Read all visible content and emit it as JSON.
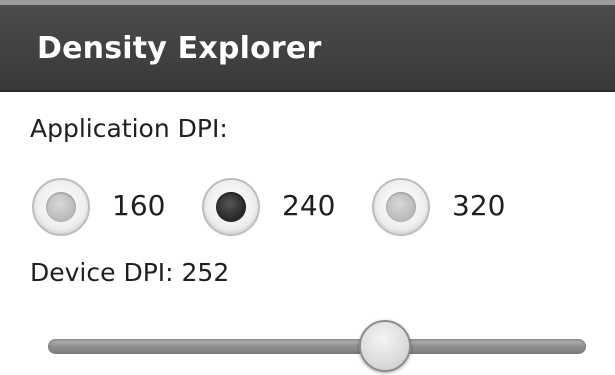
{
  "app": {
    "title": "Density Explorer"
  },
  "application_dpi": {
    "label": "Application DPI:",
    "options": [
      {
        "label": "160",
        "checked": false
      },
      {
        "label": "240",
        "checked": true
      },
      {
        "label": "320",
        "checked": false
      }
    ]
  },
  "device_dpi": {
    "label": "Device DPI: 252",
    "slider_fraction": 0.64
  },
  "colors": {
    "title_bar": "#434343",
    "title_text": "#ffffff",
    "text": "#1f1f1f",
    "background": "#ffffff"
  }
}
